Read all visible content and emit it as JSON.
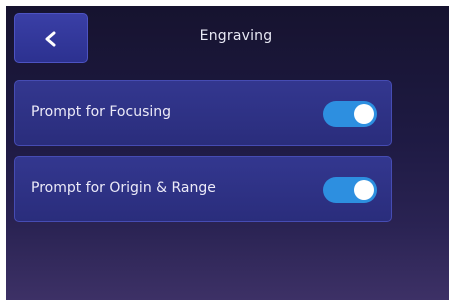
{
  "header": {
    "title": "Engraving",
    "back_icon": "chevron-left-icon"
  },
  "settings": [
    {
      "label": "Prompt for Focusing",
      "enabled": true
    },
    {
      "label": "Prompt for Origin & Range",
      "enabled": true
    }
  ],
  "colors": {
    "background_top": "#16132f",
    "background_bottom": "#3d3166",
    "panel": "#2e3288",
    "toggle_on": "#2d8fe0"
  }
}
